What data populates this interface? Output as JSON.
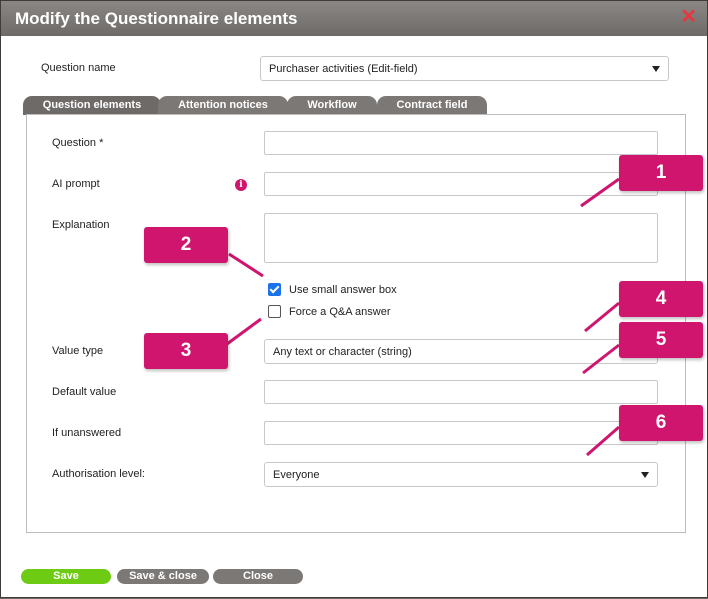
{
  "dialog": {
    "title": "Modify the Questionnaire elements",
    "close_icon": "close-icon"
  },
  "question_name": {
    "label": "Question name",
    "value": "Purchaser activities (Edit-field)"
  },
  "tabs": [
    {
      "label": "Question elements",
      "active": true
    },
    {
      "label": "Attention notices",
      "active": false
    },
    {
      "label": "Workflow",
      "active": false
    },
    {
      "label": "Contract field",
      "active": false
    }
  ],
  "fields": {
    "question": {
      "label": "Question *",
      "value": ""
    },
    "ai_prompt": {
      "label": "AI prompt",
      "value": "",
      "info_icon": "info-icon"
    },
    "explanation": {
      "label": "Explanation",
      "value": ""
    },
    "value_type": {
      "label": "Value type",
      "value": "Any text or character (string)"
    },
    "default_value": {
      "label": "Default value",
      "value": ""
    },
    "if_unanswered": {
      "label": "If unanswered",
      "value": ""
    },
    "authorisation_level": {
      "label": "Authorisation level:",
      "value": "Everyone"
    }
  },
  "checkboxes": {
    "small_answer_box": {
      "label": "Use small answer box",
      "checked": true
    },
    "force_qa_answer": {
      "label": "Force a Q&A answer",
      "checked": false
    }
  },
  "callouts": [
    "1",
    "2",
    "3",
    "4",
    "5",
    "6"
  ],
  "buttons": {
    "save": "Save",
    "save_close": "Save & close",
    "close": "Close"
  },
  "colors": {
    "accent_magenta": "#d0156e",
    "save_green": "#6ecb14",
    "titlebar_gray": "#7b7876"
  }
}
